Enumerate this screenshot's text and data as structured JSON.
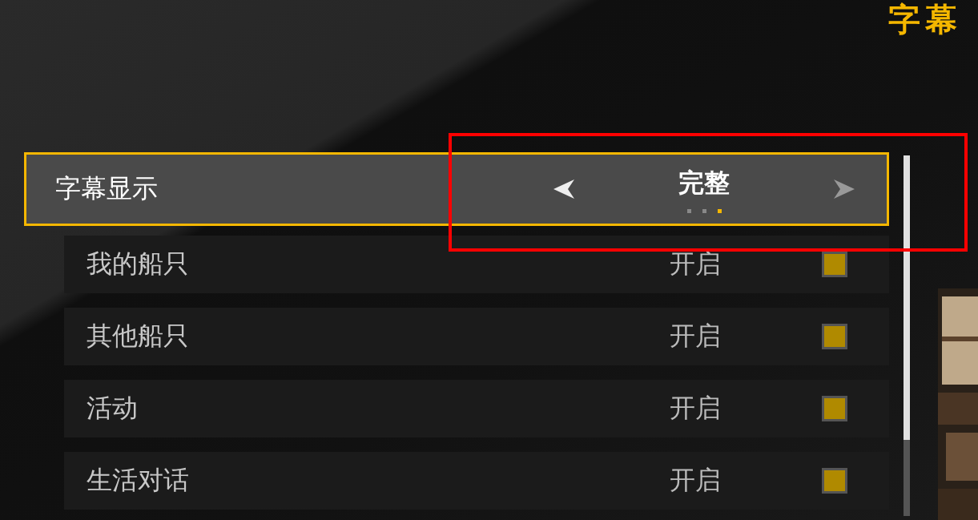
{
  "title": "字幕",
  "selector": {
    "label": "字幕显示",
    "value": "完整",
    "focused": true,
    "options": [
      {
        "selected": false
      },
      {
        "selected": false
      },
      {
        "selected": true
      }
    ]
  },
  "rows": [
    {
      "label": "我的船只",
      "status": "开启",
      "checked": true
    },
    {
      "label": "其他船只",
      "status": "开启",
      "checked": true
    },
    {
      "label": "活动",
      "status": "开启",
      "checked": true
    },
    {
      "label": "生活对话",
      "status": "开启",
      "checked": true
    }
  ],
  "annotation": {
    "shown": true
  }
}
